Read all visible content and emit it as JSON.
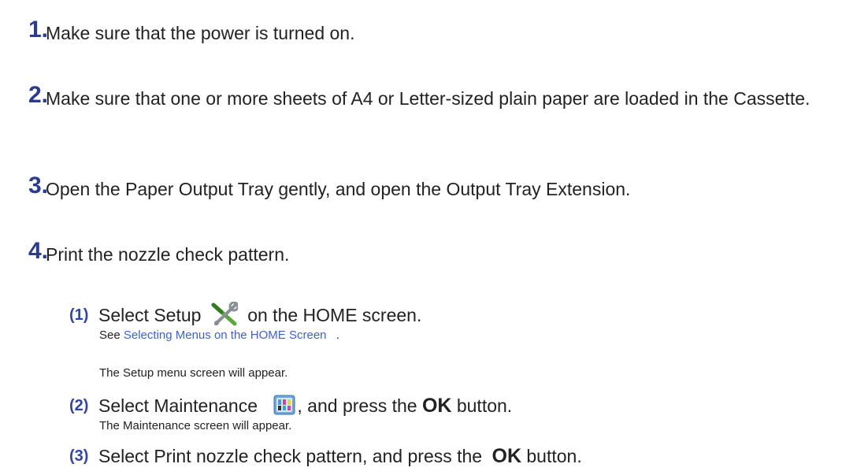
{
  "steps": [
    {
      "number": "1.",
      "text": "Make sure that the power is turned on."
    },
    {
      "number": "2.",
      "text": "Make sure that one or more sheets of A4 or Letter-sized plain paper are loaded in the Cassette."
    },
    {
      "number": "3.",
      "text": "Open the Paper Output Tray gently, and open the Output Tray Extension."
    },
    {
      "number": "4.",
      "text": "Print the nozzle check pattern."
    }
  ],
  "substeps": [
    {
      "number": "(1)",
      "text_before": "Select Setup",
      "icon": "setup-tools-icon",
      "text_after": "on the HOME screen.",
      "see_prefix": "See",
      "link_text": "Selecting Menus on the HOME Screen",
      "see_suffix": ".",
      "note": "The Setup menu screen will appear."
    },
    {
      "number": "(2)",
      "text_before": "Select Maintenance",
      "icon": "maintenance-icon",
      "text_after": ", and press the",
      "button_label": "OK",
      "text_end": "button.",
      "note": "The Maintenance screen will appear."
    },
    {
      "number": "(3)",
      "text_before": "Select Print nozzle check pattern, and press the",
      "button_label": "OK",
      "text_end": "button."
    }
  ],
  "colors": {
    "step_number": "#2b3c8f",
    "substep_number": "#3344a8",
    "link": "#3f63c6",
    "text": "#222222"
  }
}
